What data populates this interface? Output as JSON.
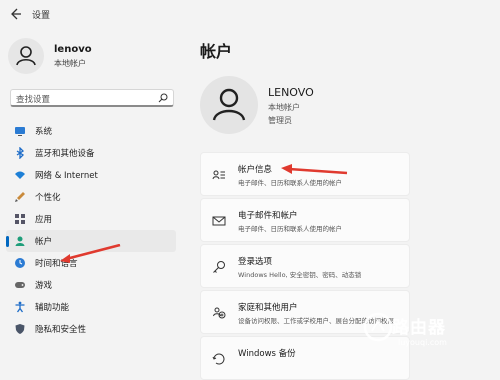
{
  "app": {
    "title": "设置"
  },
  "sidebar": {
    "user": {
      "name": "lenovo",
      "subtitle": "本地帐户"
    },
    "search": {
      "placeholder": "查找设置"
    },
    "items": [
      {
        "label": "系统",
        "icon": "monitor-icon"
      },
      {
        "label": "蓝牙和其他设备",
        "icon": "bluetooth-icon"
      },
      {
        "label": "网络 & Internet",
        "icon": "wifi-icon"
      },
      {
        "label": "个性化",
        "icon": "brush-icon"
      },
      {
        "label": "应用",
        "icon": "apps-icon"
      },
      {
        "label": "帐户",
        "icon": "person-icon",
        "selected": true
      },
      {
        "label": "时间和语言",
        "icon": "globe-clock-icon"
      },
      {
        "label": "游戏",
        "icon": "gamepad-icon"
      },
      {
        "label": "辅助功能",
        "icon": "accessibility-icon"
      },
      {
        "label": "隐私和安全性",
        "icon": "shield-icon"
      }
    ]
  },
  "main": {
    "title": "帐户",
    "profile": {
      "name": "LENOVO",
      "account_type": "本地帐户",
      "role": "管理员"
    },
    "cards": [
      {
        "title": "帐户信息",
        "desc": "电子邮件、日历和联系人使用的帐户",
        "icon": "account-info-icon"
      },
      {
        "title": "电子邮件和帐户",
        "desc": "电子邮件、日历和联系人使用的帐户",
        "icon": "mail-icon"
      },
      {
        "title": "登录选项",
        "desc": "Windows Hello, 安全密钥、密码、动态锁",
        "icon": "key-icon"
      },
      {
        "title": "家庭和其他用户",
        "desc": "设备访问权限、工作或学校用户、展台分配的访问权限",
        "icon": "family-icon"
      },
      {
        "title": "Windows 备份",
        "desc": "",
        "icon": "backup-icon"
      }
    ]
  },
  "watermark": {
    "title": "路由器",
    "url": "luyouqi.com"
  },
  "colors": {
    "accent": "#0067c0",
    "annotation_arrow": "#e03a2f"
  }
}
